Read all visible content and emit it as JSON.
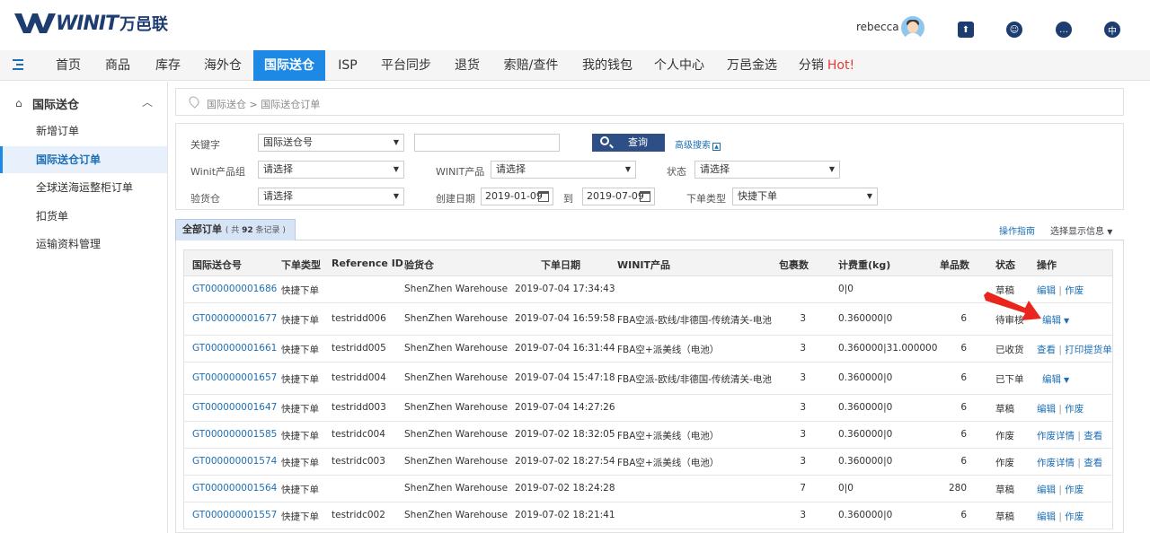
{
  "brand": {
    "logo_text": "WINIT",
    "logo_cn": "万邑联"
  },
  "user": {
    "name": "rebecca"
  },
  "header_icons": [
    {
      "name": "upload-icon",
      "glyph": "⬆"
    },
    {
      "name": "support-icon",
      "glyph": "☺"
    },
    {
      "name": "message-icon",
      "glyph": "…"
    },
    {
      "name": "language-icon",
      "glyph": "中"
    }
  ],
  "nav": {
    "items": [
      "首页",
      "商品",
      "库存",
      "海外仓",
      "国际送仓",
      "ISP",
      "平台同步",
      "退货",
      "索赔/查件",
      "我的钱包",
      "个人中心",
      "万邑金选",
      "分销"
    ],
    "active_index": 4,
    "hot": "Hot!"
  },
  "sidebar": {
    "title": "国际送仓",
    "items": [
      "新增订单",
      "国际送仓订单",
      "全球送海运整柜订单",
      "扣货单",
      "运输资料管理"
    ],
    "active_index": 1
  },
  "breadcrumb": "国际送仓 > 国际送仓订单",
  "filters": {
    "keyword_label": "关键字",
    "keyword_type": "国际送仓号",
    "keyword_value": "",
    "query_label": "查询",
    "advanced_label": "高级搜索",
    "product_group_label": "Winit产品组",
    "product_group_value": "请选择",
    "winit_product_label": "WINIT产品",
    "winit_product_value": "请选择",
    "status_label": "状态",
    "status_value": "请选择",
    "inspection_label": "验货仓",
    "inspection_value": "请选择",
    "date_label": "创建日期",
    "date_from": "2019-01-09",
    "date_to_label": "到",
    "date_to": "2019-07-09",
    "order_type_label": "下单类型",
    "order_type_value": "快捷下单"
  },
  "orders": {
    "tab_label": "全部订单",
    "count_prefix": "( 共 ",
    "count": "92",
    "count_suffix": " 条记录 )",
    "guide_label": "操作指南",
    "display_label": "选择显示信息",
    "columns": [
      "国际送仓号",
      "下单类型",
      "Reference ID",
      "验货仓",
      "下单日期",
      "WINIT产品",
      "包裹数",
      "计费重(kg)",
      "单品数",
      "状态",
      "操作"
    ],
    "rows": [
      {
        "id": "GT000000001686",
        "type": "快捷下单",
        "ref": "",
        "warehouse": "ShenZhen Warehouse",
        "date": "2019-07-04 17:34:43",
        "product": "",
        "packages": "",
        "weight": "0|0",
        "items": "",
        "status": "草稿",
        "ops": [
          "编辑",
          "作废"
        ],
        "dropdown": false
      },
      {
        "id": "GT000000001677",
        "type": "快捷下单",
        "ref": "testridd006",
        "warehouse": "ShenZhen Warehouse",
        "date": "2019-07-04 16:59:58",
        "product": "FBA空派-欧线/非德国-传统清关-电池",
        "packages": "3",
        "weight": "0.360000|0",
        "items": "6",
        "status": "待审核",
        "ops": [
          "编辑"
        ],
        "dropdown": true
      },
      {
        "id": "GT000000001661",
        "type": "快捷下单",
        "ref": "testridd005",
        "warehouse": "ShenZhen Warehouse",
        "date": "2019-07-04 16:31:44",
        "product": "FBA空+派美线（电池）",
        "packages": "3",
        "weight": "0.360000|31.000000",
        "items": "6",
        "status": "已收货",
        "ops": [
          "查看",
          "打印提货单"
        ],
        "dropdown": false
      },
      {
        "id": "GT000000001657",
        "type": "快捷下单",
        "ref": "testridd004",
        "warehouse": "ShenZhen Warehouse",
        "date": "2019-07-04 15:47:18",
        "product": "FBA空派-欧线/非德国-传统清关-电池",
        "packages": "3",
        "weight": "0.360000|0",
        "items": "6",
        "status": "已下单",
        "ops": [
          "编辑"
        ],
        "dropdown": true
      },
      {
        "id": "GT000000001647",
        "type": "快捷下单",
        "ref": "testridd003",
        "warehouse": "ShenZhen Warehouse",
        "date": "2019-07-04 14:27:26",
        "product": "",
        "packages": "3",
        "weight": "0.360000|0",
        "items": "6",
        "status": "草稿",
        "ops": [
          "编辑",
          "作废"
        ],
        "dropdown": false
      },
      {
        "id": "GT000000001585",
        "type": "快捷下单",
        "ref": "testridc004",
        "warehouse": "ShenZhen Warehouse",
        "date": "2019-07-02 18:32:05",
        "product": "FBA空+派美线（电池）",
        "packages": "3",
        "weight": "0.360000|0",
        "items": "6",
        "status": "作废",
        "ops": [
          "作废详情",
          "查看"
        ],
        "dropdown": false
      },
      {
        "id": "GT000000001574",
        "type": "快捷下单",
        "ref": "testridc003",
        "warehouse": "ShenZhen Warehouse",
        "date": "2019-07-02 18:27:54",
        "product": "FBA空+派美线（电池）",
        "packages": "3",
        "weight": "0.360000|0",
        "items": "6",
        "status": "作废",
        "ops": [
          "作废详情",
          "查看"
        ],
        "dropdown": false
      },
      {
        "id": "GT000000001564",
        "type": "快捷下单",
        "ref": "",
        "warehouse": "ShenZhen Warehouse",
        "date": "2019-07-02 18:24:28",
        "product": "",
        "packages": "7",
        "weight": "0|0",
        "items": "280",
        "status": "草稿",
        "ops": [
          "编辑",
          "作废"
        ],
        "dropdown": false
      },
      {
        "id": "GT000000001557",
        "type": "快捷下单",
        "ref": "testridc002",
        "warehouse": "ShenZhen Warehouse",
        "date": "2019-07-02 18:21:41",
        "product": "",
        "packages": "3",
        "weight": "0.360000|0",
        "items": "6",
        "status": "草稿",
        "ops": [
          "编辑",
          "作废"
        ],
        "dropdown": false
      }
    ]
  },
  "colors": {
    "accent": "#1e88e5",
    "brand": "#1d3d70",
    "link": "#1d6fb5",
    "hot": "#e53935",
    "pointer": "#e8261d"
  }
}
